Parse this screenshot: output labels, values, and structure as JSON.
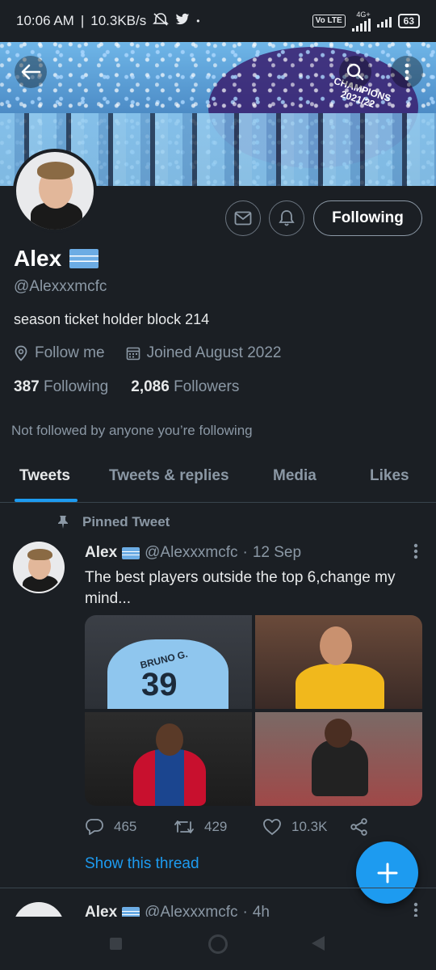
{
  "status_bar": {
    "time": "10:06 AM",
    "speed": "10.3KB/s",
    "volte": "Vo LTE",
    "network": "4G+",
    "battery": "63"
  },
  "banner": {
    "champions_text": "CHAMPIONS 2021/22",
    "back_icon": "arrow-left-icon",
    "search_icon": "search-icon",
    "more_icon": "more-vertical-icon"
  },
  "profile": {
    "name": "Alex",
    "handle": "@Alexxxmcfc",
    "bio": "season ticket holder block 214",
    "location": "Follow me",
    "joined": "Joined August 2022",
    "following_count": "387",
    "following_label": "Following",
    "followers_count": "2,086",
    "followers_label": "Followers",
    "not_followed": "Not followed by anyone you’re following",
    "follow_button": "Following"
  },
  "tabs": [
    {
      "label": "Tweets",
      "active": true
    },
    {
      "label": "Tweets & replies",
      "active": false
    },
    {
      "label": "Media",
      "active": false
    },
    {
      "label": "Likes",
      "active": false
    }
  ],
  "tweet": {
    "pinned_label": "Pinned Tweet",
    "name": "Alex",
    "handle": "@Alexxxmcfc",
    "separator": "·",
    "date": "12 Sep",
    "text": "The best players outside the top 6,change my mind...",
    "images": [
      {
        "caption": "BRUNO G.",
        "number": "39"
      },
      {
        "caption": "",
        "number": ""
      },
      {
        "caption": "",
        "number": ""
      },
      {
        "caption": "",
        "number": ""
      }
    ],
    "replies": "465",
    "retweets": "429",
    "likes": "10.3K",
    "show_thread": "Show this thread"
  },
  "tweet2": {
    "name": "Alex",
    "handle": "@Alexxxmcfc",
    "separator": "·",
    "time": "4h"
  },
  "colors": {
    "accent": "#1d9bf0",
    "background": "#1b1f24",
    "muted": "#8b98a5"
  }
}
